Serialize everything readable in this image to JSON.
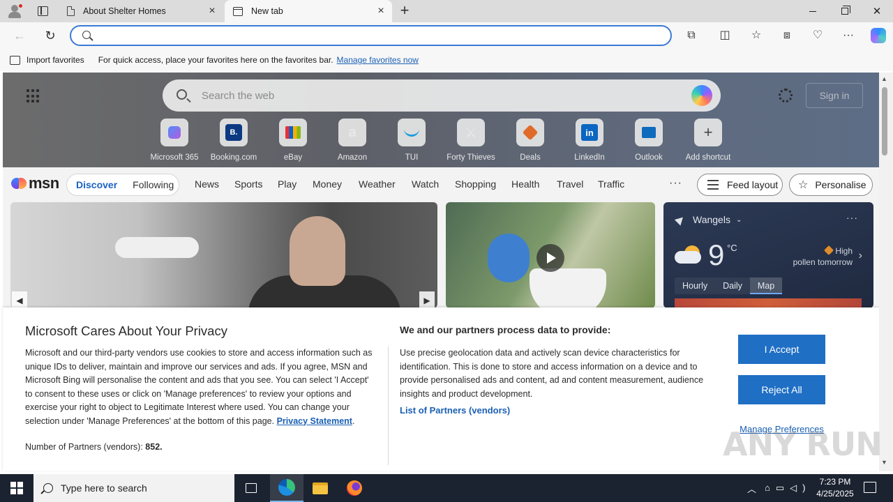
{
  "browser": {
    "tabs": [
      {
        "title": "About Shelter Homes",
        "active": false
      },
      {
        "title": "New tab",
        "active": true
      }
    ],
    "address_value": "",
    "favorites_bar": {
      "import_label": "Import favorites",
      "message": "For quick access, place your favorites here on the favorites bar.",
      "link": "Manage favorites now"
    }
  },
  "newtab": {
    "search_placeholder": "Search the web",
    "sign_in": "Sign in",
    "shortcuts": [
      {
        "label": "Microsoft 365",
        "icon": "microsoft365-icon",
        "glyph": "",
        "color": "#6a5fd8"
      },
      {
        "label": "Booking.com",
        "icon": "booking-icon",
        "glyph": "B.",
        "color": "#0b3a82"
      },
      {
        "label": "eBay",
        "icon": "ebay-icon",
        "glyph": "",
        "color": "#e53238"
      },
      {
        "label": "Amazon",
        "icon": "amazon-icon",
        "glyph": "a",
        "color": "#111111"
      },
      {
        "label": "TUI",
        "icon": "tui-icon",
        "glyph": "",
        "color": "#1a9be0"
      },
      {
        "label": "Forty Thieves",
        "icon": "forty-thieves-icon",
        "glyph": "",
        "color": "#222222"
      },
      {
        "label": "Deals",
        "icon": "deals-icon",
        "glyph": "",
        "color": "#e06a2a"
      },
      {
        "label": "LinkedIn",
        "icon": "linkedin-icon",
        "glyph": "in",
        "color": "#0a66c2"
      },
      {
        "label": "Outlook",
        "icon": "outlook-icon",
        "glyph": "",
        "color": "#0f6cbd"
      },
      {
        "label": "Add shortcut",
        "icon": "plus-icon",
        "glyph": "+",
        "color": "#444444"
      }
    ]
  },
  "msn": {
    "logo": "msn",
    "discover": "Discover",
    "following": "Following",
    "categories": [
      "News",
      "Sports",
      "Play",
      "Money",
      "Weather",
      "Watch",
      "Shopping",
      "Health",
      "Travel",
      "Traffic"
    ],
    "more": "···",
    "feed_layout": "Feed layout",
    "personalise": "Personalise"
  },
  "weather": {
    "location": "Wangels",
    "temperature": "9",
    "unit": "°C",
    "pollen_level": "High",
    "pollen_label": "pollen tomorrow",
    "tabs": [
      "Hourly",
      "Daily",
      "Map"
    ],
    "active_tab": "Map"
  },
  "privacy": {
    "title": "Microsoft Cares About Your Privacy",
    "body": "Microsoft and our third-party vendors use cookies to store and access information such as unique IDs to deliver, maintain and improve our services and ads. If you agree, MSN and Microsoft Bing will personalise the content and ads that you see. You can select 'I Accept' to consent to these uses or click on 'Manage preferences' to review your options and exercise your right to object to Legitimate Interest where used.  You can change your selection under 'Manage Preferences' at the bottom of this page.",
    "privacy_link": "Privacy Statement",
    "partners_label": "Number of Partners (vendors):",
    "partners_count": "852.",
    "data_title": "We and our partners process data to provide:",
    "data_body": "Use precise geolocation data and actively scan device characteristics for identification. This is done to store and access information on a device and to provide personalised ads and content, ad and content measurement, audience insights and product development.",
    "vendors_link": "List of Partners (vendors)",
    "accept": "I Accept",
    "reject": "Reject All",
    "manage": "Manage Preferences"
  },
  "watermark": "ANY RUN",
  "taskbar": {
    "search_placeholder": "Type here to search",
    "time": "7:23 PM",
    "date": "4/25/2025"
  }
}
